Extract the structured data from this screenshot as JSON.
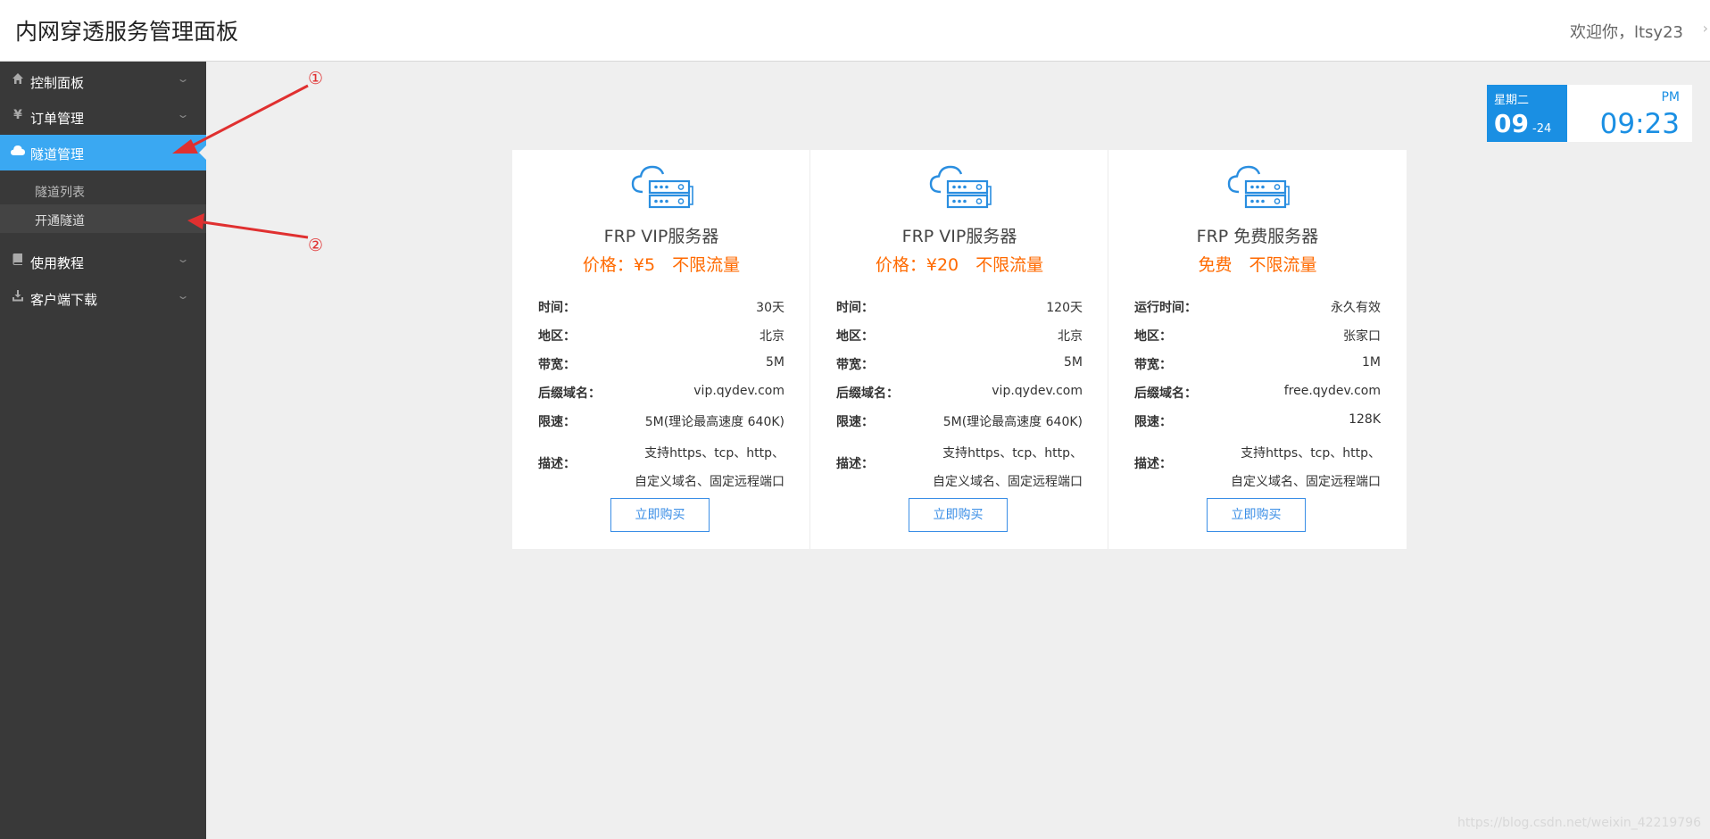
{
  "header": {
    "title": "内网穿透服务管理面板",
    "welcome": "欢迎你，ltsy23"
  },
  "sidebar": {
    "items": [
      {
        "label": "控制面板",
        "icon": "home-icon"
      },
      {
        "label": "订单管理",
        "icon": "yen-icon"
      },
      {
        "label": "隧道管理",
        "icon": "cloud-icon",
        "active": true
      },
      {
        "label": "使用教程",
        "icon": "book-icon"
      },
      {
        "label": "客户端下载",
        "icon": "download-icon"
      }
    ],
    "subitems": [
      {
        "label": "隧道列表"
      },
      {
        "label": "开通隧道",
        "current": true
      }
    ]
  },
  "clock": {
    "weekday": "星期二",
    "day": "09",
    "month": "-24",
    "ampm": "PM",
    "time": "09:23"
  },
  "cards": [
    {
      "name": "FRP VIP服务器",
      "price": "价格：¥5　不限流量",
      "rows": [
        {
          "k": "时间：",
          "v": "30天"
        },
        {
          "k": "地区：",
          "v": "北京"
        },
        {
          "k": "带宽：",
          "v": "5M"
        },
        {
          "k": "后缀域名：",
          "v": "vip.qydev.com"
        },
        {
          "k": "限速：",
          "v": "5M(理论最高速度 640K)"
        }
      ],
      "desc_label": "描述：",
      "desc_line1": "支持https、tcp、http、",
      "desc_line2": "自定义域名、固定远程端口",
      "button": "立即购买"
    },
    {
      "name": "FRP VIP服务器",
      "price": "价格：¥20　不限流量",
      "rows": [
        {
          "k": "时间：",
          "v": "120天"
        },
        {
          "k": "地区：",
          "v": "北京"
        },
        {
          "k": "带宽：",
          "v": "5M"
        },
        {
          "k": "后缀域名：",
          "v": "vip.qydev.com"
        },
        {
          "k": "限速：",
          "v": "5M(理论最高速度 640K)"
        }
      ],
      "desc_label": "描述：",
      "desc_line1": "支持https、tcp、http、",
      "desc_line2": "自定义域名、固定远程端口",
      "button": "立即购买"
    },
    {
      "name": "FRP 免费服务器",
      "price": "免费　不限流量",
      "rows": [
        {
          "k": "运行时间：",
          "v": "永久有效"
        },
        {
          "k": "地区：",
          "v": "张家口"
        },
        {
          "k": "带宽：",
          "v": "1M"
        },
        {
          "k": "后缀域名：",
          "v": "free.qydev.com"
        },
        {
          "k": "限速：",
          "v": "128K"
        }
      ],
      "desc_label": "描述：",
      "desc_line1": "支持https、tcp、http、",
      "desc_line2": "自定义域名、固定远程端口",
      "button": "立即购买"
    }
  ],
  "annotations": {
    "one": "①",
    "two": "②",
    "color": "#e03030"
  },
  "watermark": "https://blog.csdn.net/weixin_42219796",
  "colors": {
    "accent": "#3aa8f2",
    "clock_blue": "#1a8fe3",
    "price_orange": "#ff6a00",
    "sidebar_bg": "#393939"
  }
}
